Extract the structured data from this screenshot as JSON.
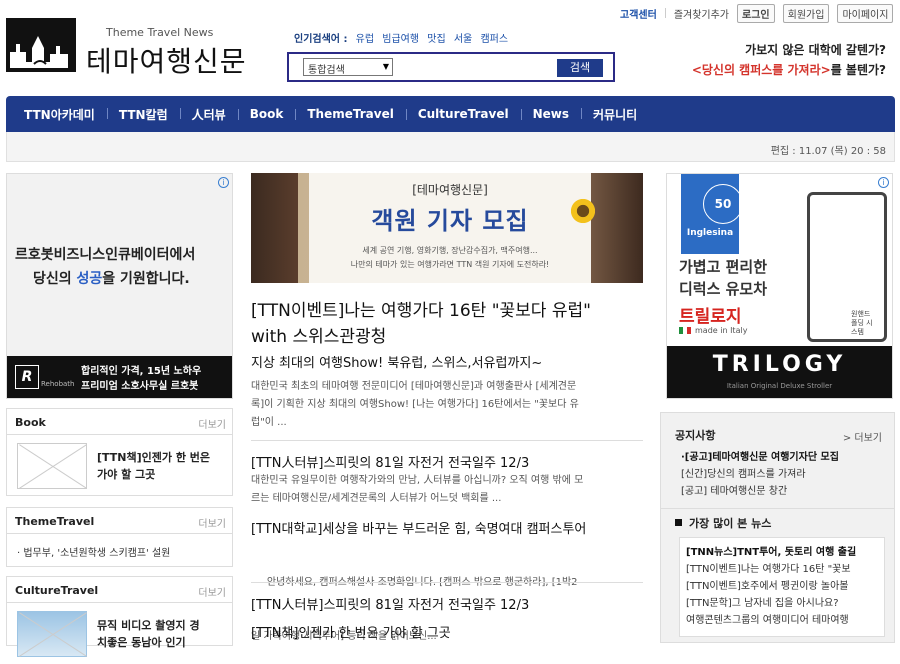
{
  "toplinks": {
    "center": "고객센터",
    "favorite": "즐겨찾기추가",
    "login": "로그인",
    "join": "회원가입",
    "mypage": "마이페이지"
  },
  "logo": {
    "en": "Theme Travel News",
    "ko": "테마여행신문"
  },
  "search": {
    "popular_label": "인기검색어 :",
    "popular_keywords": [
      "유럽",
      "빔급여행",
      "맛집",
      "서울",
      "캠퍼스"
    ],
    "select_value": "통합검색",
    "button": "검색"
  },
  "promo": {
    "line1": "가보지 않은 대학에 갈텐가?",
    "line2_red": "<당신의 캠퍼스를 가져라>",
    "line2_rest": "를 볼텐가?"
  },
  "nav": {
    "items": [
      "TTN아카데미",
      "TTN칼럼",
      "人터뷰",
      "Book",
      "ThemeTravel",
      "CultureTravel",
      "News",
      "커뮤니티"
    ]
  },
  "edit_time": "편집 : 11.07 (목) 20 : 58",
  "left_banner": {
    "line1": "르호봇비즈니스인큐베이터에서",
    "line2_pre": "당신의 ",
    "line2_hi": "성공",
    "line2_post": "을 기원합니다.",
    "brand": "Rehobath",
    "bottom1": "합리적인 가격, 15년 노하우",
    "bottom2": "프리미엄 소호사무실 르호봇"
  },
  "box_book": {
    "title": "Book",
    "more": "더보기",
    "item_line1": "[TTN책]인젠가 한 번은",
    "item_line2": "가야 할 그곳"
  },
  "box_theme": {
    "title": "ThemeTravel",
    "more": "더보기",
    "item": "· 법무부, '소년원학생 스키캠프' 설원"
  },
  "box_culture": {
    "title": "CultureTravel",
    "more": "더보기",
    "item_line1": "뮤직 비디오 촬영지 경",
    "item_line2": "치좋은 동남아 인기"
  },
  "center_banner": {
    "tag": "[테마여행신문]",
    "title": "객원 기자 모집",
    "sub1": "세계 공연 기행, 영화기행, 장난감수집가, 맥주여행...",
    "sub2": "나만의 테마가 있는 여행가라면 TTN 객원 기자에 도전하라!"
  },
  "lead": {
    "title_l1": "[TTN이벤트]나는 여행가다 16탄 \"꽃보다 유럽\"",
    "title_l2": "with 스위스관광청",
    "subtitle": "지상 최대의 여행Show! 북유럽, 스위스,서유럽까지~",
    "body_l1": "대한민국 최초의 테마여행 전문미디어 [테마여행신문]과 여행출판사 [세계견문",
    "body_l2": "록]이 기획한 지상 최대의 여행Show! [나는 여행가다] 16탄에서는 \"꽃보다 유",
    "body_l3": "럽\"이 ..."
  },
  "articles": [
    {
      "title": "[TTN人터뷰]스피릿의 81일 자전거 전국일주 12/3",
      "body_l1": "대한민국 유일무이한 여행작가와의 만남, 人터뷰를 아십니까? 오직 여행 밖에 모",
      "body_l2": "르는 테마여행신문/세계견문록의 人터뷰가 어느덧 백회를 ..."
    },
    {
      "title": "[TTN대학교]세상을 바꾸는 부드러운 힘, 숙명여대 캠퍼스투어",
      "body_l1": "     안녕하세요, 캠퍼스해설사 조명화입니다. [캠퍼스 밖으로 행군하라], [1박2",
      "body_l2": "일 가족여행 시티투어] 등의 책을 읽어보신..."
    },
    {
      "title": "[TTN人터뷰]스피릿의 81일 자전거 전국일주 12/3"
    },
    {
      "title": "[TTN책]인젠가 한 번은 가야 할 그곳"
    }
  ],
  "right_banner": {
    "anniv": "50",
    "brand": "Inglesina",
    "line1": "가볍고 편리한",
    "line2": "디럭스 유모차",
    "line3": "트릴로지",
    "made": "made in Italy",
    "side": "원핸드 폴딩 시스템",
    "logo": "TRILOGY",
    "logo_sub": "Italian Original Deluxe Stroller"
  },
  "notice": {
    "title": "공지사항",
    "more": "> 더보기",
    "items": [
      "·[공고]테마여행신문 여행기자단 모집",
      "[신간]당신의 캠퍼스를 가져라",
      "[공고] 테마여행신문 창간"
    ]
  },
  "popular": {
    "title": "가장 많이 본 뉴스",
    "items": [
      "[TNN뉴스]TNT투어, 돗토리 여행 출길",
      "[TTN이벤트]나는 여행가다 16탄 \"꽃보",
      "[TTN이벤트]호주에서 펭귄이랑 놀아볼",
      "[TTN문학]그 남자네 집을 아시나요?",
      "여행콘텐츠그룹의 여행미디어 테마여행"
    ]
  },
  "colors": {
    "nav_bg": "#1f3b8a",
    "accent_red": "#d4342c",
    "link_blue": "#1a4fa8"
  }
}
